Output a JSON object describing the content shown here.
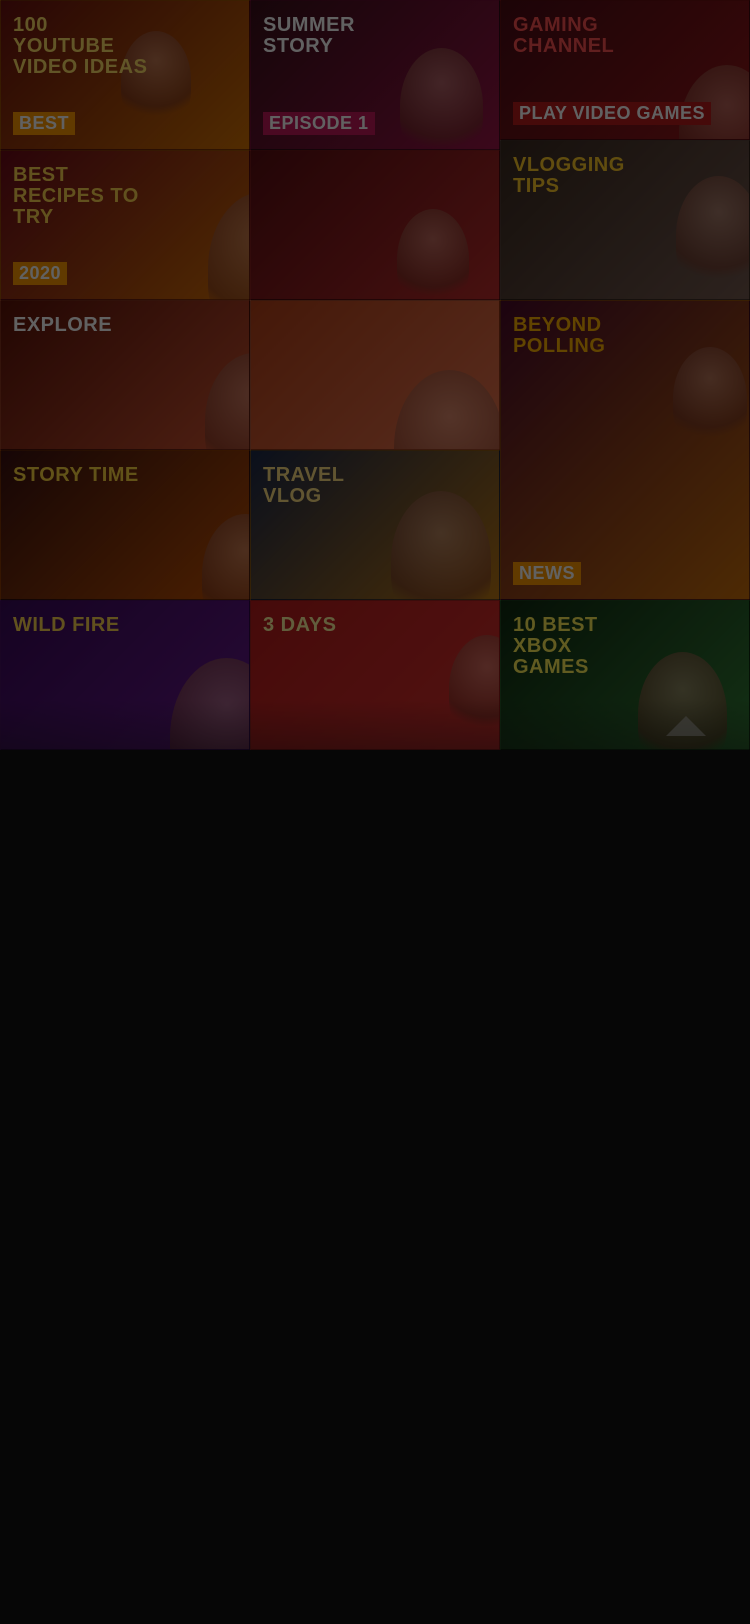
{
  "thumbnails": [
    {
      "id": "t1",
      "caption": "100 Youtube Video Ideas",
      "sub": "Best",
      "bg": "#6a1010",
      "accent": "#ff9a00",
      "fg": "#ffe066"
    },
    {
      "id": "t2",
      "caption": "Summer Story",
      "sub": "Episode 1",
      "bg": "#3a0f1a",
      "accent": "#c2185b",
      "fg": "#ffffff"
    },
    {
      "id": "t3",
      "caption": "Gaming Channel",
      "sub": "Play Video Games",
      "bg": "#4a0c14",
      "accent": "#b71c1c",
      "fg": "#ff5252"
    },
    {
      "id": "t4",
      "caption": "Best Recipes to Try",
      "sub": "2020",
      "bg": "#6d0a1a",
      "accent": "#ff9800",
      "fg": "#ffd54f"
    },
    {
      "id": "t5",
      "caption": "",
      "sub": "",
      "bg": "#5a0e12",
      "accent": "#e53935",
      "fg": "#ffffff"
    },
    {
      "id": "t6",
      "caption": "Vlogging Tips",
      "sub": "",
      "bg": "#3a2a20",
      "accent": "#8d6e63",
      "fg": "#ffca28"
    },
    {
      "id": "t7",
      "caption": "Explore",
      "sub": "",
      "bg": "#5c1208",
      "accent": "#ff7043",
      "fg": "#ffffff"
    },
    {
      "id": "t8",
      "caption": "",
      "sub": "",
      "bg": "#b34018",
      "accent": "#ff8a65",
      "fg": "#ffffff"
    },
    {
      "id": "t9",
      "caption": "Beyond Polling",
      "sub": "News",
      "bg": "#4a0a2a",
      "accent": "#ff9800",
      "fg": "#ffb300"
    },
    {
      "id": "t10",
      "caption": "Story Time",
      "sub": "",
      "bg": "#3a1010",
      "accent": "#ff6f00",
      "fg": "#ffd740"
    },
    {
      "id": "t11",
      "caption": "Travel Vlog",
      "sub": "",
      "bg": "#1c2a4a",
      "accent": "#ff9800",
      "fg": "#ffe082"
    },
    {
      "id": "t12",
      "caption": "Wild Fire",
      "sub": "",
      "bg": "#3a0a5a",
      "accent": "#7b1fa2",
      "fg": "#ffd54f"
    },
    {
      "id": "t13",
      "caption": "3 Days",
      "sub": "",
      "bg": "#b71c1c",
      "accent": "#e53935",
      "fg": "#fff59d"
    },
    {
      "id": "t14",
      "caption": "10 Best Xbox Games",
      "sub": "",
      "bg": "#0f2a10",
      "accent": "#43a047",
      "fg": "#ffee58"
    }
  ],
  "footer_text": {
    "line1": "",
    "line2": ""
  },
  "icons": {
    "scroll_up": "chevron-up-icon"
  }
}
